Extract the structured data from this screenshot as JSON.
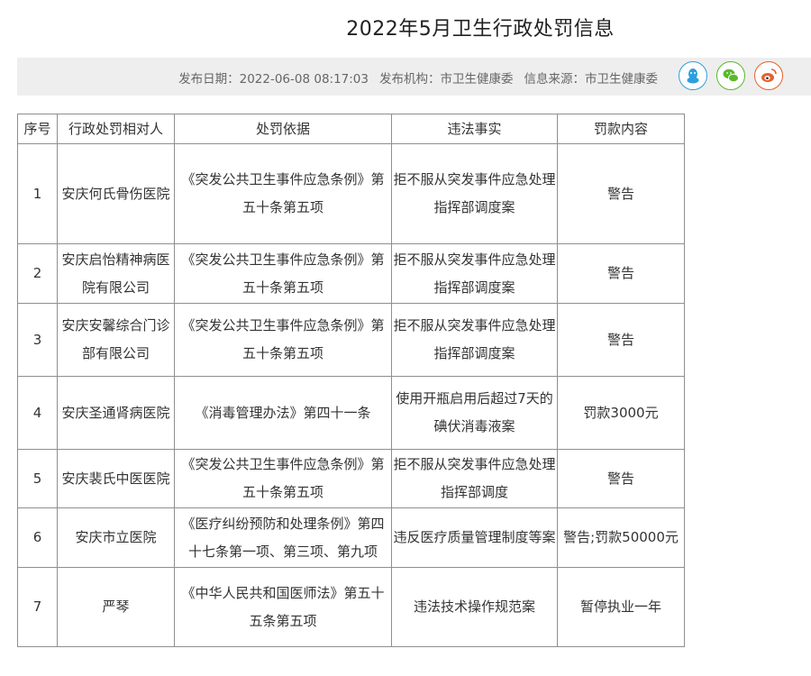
{
  "title": "2022年5月卫生行政处罚信息",
  "meta": {
    "publish_date": "发布日期：2022-06-08 08:17:03",
    "publisher": "发布机构：市卫生健康委",
    "source": "信息来源：市卫生健康委"
  },
  "share_icons": [
    "qq-icon",
    "wechat-icon",
    "weibo-icon"
  ],
  "colors": {
    "qq": "#2d9fdc",
    "wechat": "#5bb82c",
    "weibo": "#e8602a",
    "meta_bar": "#eeeeee"
  },
  "table": {
    "headers": [
      "序号",
      "行政处罚相对人",
      "处罚依据",
      "违法事实",
      "罚款内容"
    ],
    "rows": [
      [
        "1",
        "安庆何氏骨伤医院",
        "《突发公共卫生事件应急条例》第五十条第五项",
        "拒不服从突发事件应急处理指挥部调度案",
        "警告"
      ],
      [
        "2",
        "安庆启怡精神病医院有限公司",
        "《突发公共卫生事件应急条例》第五十条第五项",
        "拒不服从突发事件应急处理指挥部调度案",
        "警告"
      ],
      [
        "3",
        "安庆安馨综合门诊部有限公司",
        "《突发公共卫生事件应急条例》第五十条第五项",
        "拒不服从突发事件应急处理指挥部调度案",
        "警告"
      ],
      [
        "4",
        "安庆圣通肾病医院",
        "《消毒管理办法》第四十一条",
        "使用开瓶启用后超过7天的碘伏消毒液案",
        "罚款3000元"
      ],
      [
        "5",
        "安庆裴氏中医医院",
        "《突发公共卫生事件应急条例》第五十条第五项",
        "拒不服从突发事件应急处理指挥部调度",
        "警告"
      ],
      [
        "6",
        "安庆市立医院",
        "《医疗纠纷预防和处理条例》第四十七条第一项、第三项、第九项",
        "违反医疗质量管理制度等案",
        "警告;罚款50000元"
      ],
      [
        "7",
        "严琴",
        "《中华人民共和国医师法》第五十五条第五项",
        "违法技术操作规范案",
        "暂停执业一年"
      ]
    ]
  }
}
